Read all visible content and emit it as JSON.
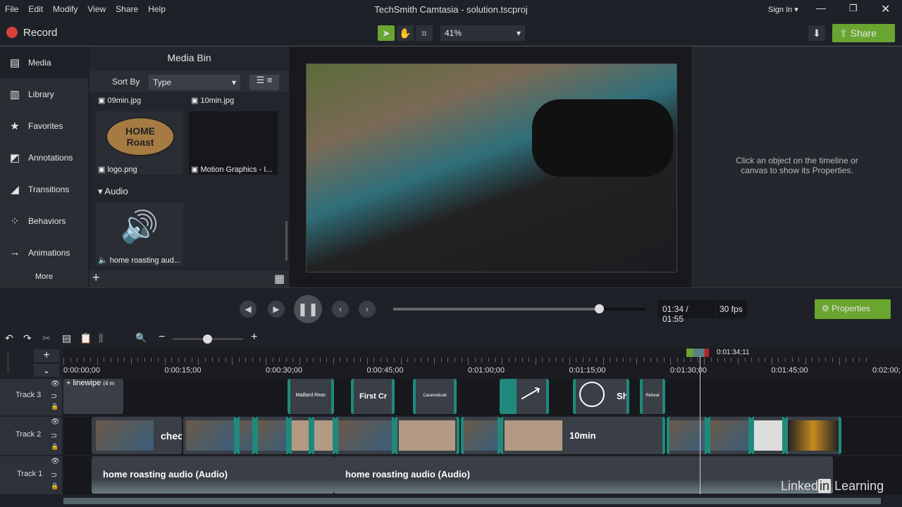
{
  "menu": [
    "File",
    "Edit",
    "Modify",
    "View",
    "Share",
    "Help"
  ],
  "window_title": "TechSmith Camtasia - solution.tscproj",
  "sign_in": "Sign In",
  "record": "Record",
  "zoom_level": "41%",
  "share": "Share",
  "sidebar": [
    "Media",
    "Library",
    "Favorites",
    "Annotations",
    "Transitions",
    "Behaviors",
    "Animations"
  ],
  "more": "More",
  "media_bin": {
    "title": "Media Bin",
    "sort_by": "Sort By",
    "sort_value": "Type",
    "items": [
      "09min.jpg",
      "10min.jpg",
      "logo.png",
      "Motion Graphics - I..."
    ],
    "audio_header": "Audio",
    "audio_item": "home roasting aud...",
    "logo_line1": "HOME",
    "logo_line2": "Roast"
  },
  "properties_hint": "Click an object on the timeline or canvas to show its Properties.",
  "playback": {
    "time": "01:34 / 01:55",
    "fps": "30 fps",
    "progress": 0.817,
    "properties": "Properties"
  },
  "timeline": {
    "playhead": "0:01:34;11",
    "ticks": [
      "0:00:00;00",
      "0:00:15;00",
      "0:00:30;00",
      "0:00:45;00",
      "0:01:00;00",
      "0:01:15;00",
      "0:01:30;00",
      "0:01:45;00",
      "0:02:00;"
    ],
    "tracks": [
      "Track 3",
      "Track 2",
      "Track 1"
    ],
    "track3_clips": [
      "linewipe",
      "(4 m",
      "Maillard Reac",
      "First Cr",
      "Caramelizati",
      "",
      "",
      "Sh",
      "Reheat"
    ],
    "track2_labels": [
      "chec",
      "10min"
    ],
    "track1_labels": [
      "home roasting audio (Audio)",
      "home roasting audio (Audio)"
    ]
  },
  "watermark": "Linked in Learning",
  "accent": "#6aa531"
}
